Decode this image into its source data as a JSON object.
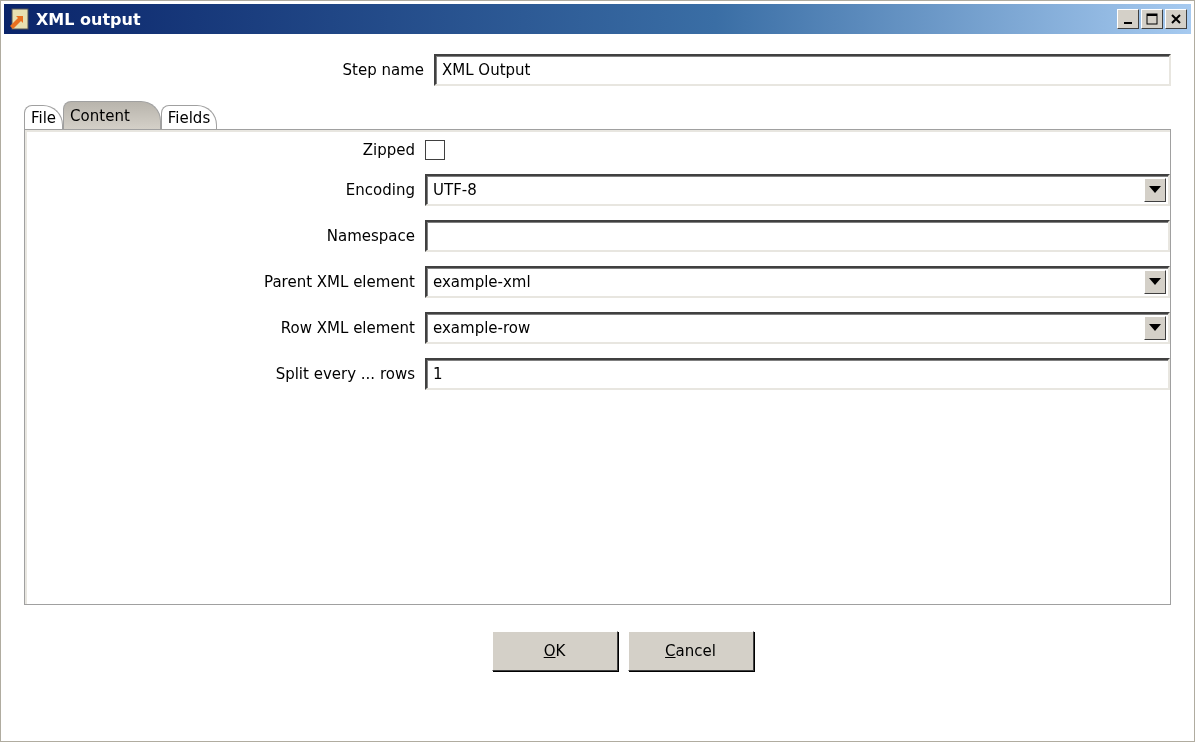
{
  "window": {
    "title": "XML output"
  },
  "step_name": {
    "label": "Step name",
    "value": "XML Output"
  },
  "tabs": [
    {
      "label": "File",
      "selected": false
    },
    {
      "label": "Content",
      "selected": true
    },
    {
      "label": "Fields",
      "selected": false
    }
  ],
  "fields": [
    {
      "kind": "checkbox",
      "label": "Zipped",
      "checked": false
    },
    {
      "kind": "combo",
      "label": "Encoding",
      "value": "UTF-8"
    },
    {
      "kind": "text",
      "label": "Namespace"
    },
    {
      "kind": "combo",
      "label": "Parent XML element",
      "value": "example-xml"
    },
    {
      "kind": "combo",
      "label": "Row XML element",
      "value": "example-row"
    },
    {
      "kind": "text",
      "label": "Split every ... rows",
      "value": "1"
    }
  ],
  "buttons": [
    {
      "accel": "O",
      "rest": "K"
    },
    {
      "accel": "C",
      "rest": "ancel"
    }
  ]
}
